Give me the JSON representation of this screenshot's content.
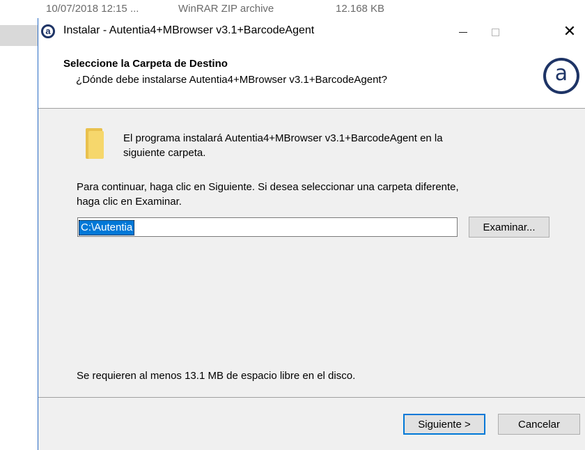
{
  "background_row": {
    "date": "10/07/2018 12:15 ...",
    "type": "WinRAR ZIP archive",
    "size": "12.168 KB"
  },
  "window": {
    "title": "Instalar - Autentia4+MBrowser v3.1+BarcodeAgent",
    "controls": {
      "minimize_icon": "minimize-icon",
      "maximize_icon": "maximize-icon",
      "close_label": "✕"
    }
  },
  "header": {
    "title": "Seleccione la Carpeta de Destino",
    "subtitle": "¿Dónde debe instalarse Autentia4+MBrowser v3.1+BarcodeAgent?",
    "logo_letter": "a",
    "logo_color": "#1e3466"
  },
  "body": {
    "intro_line1": "El programa instalará Autentia4+MBrowser v3.1+BarcodeAgent en la",
    "intro_line2": "siguiente carpeta.",
    "continue_line1": "Para continuar, haga clic en Siguiente. Si desea seleccionar una carpeta diferente,",
    "continue_line2": "haga clic en Examinar.",
    "destination_path": "C:\\Autentia",
    "browse_label": "Examinar...",
    "space_required": "Se requieren al menos 13.1 MB de espacio libre en el disco."
  },
  "footer": {
    "next_label": "Siguiente >",
    "cancel_label": "Cancelar"
  },
  "colors": {
    "accent": "#0078d7",
    "window_bg": "#f0f0f0",
    "folder": "#f6d76c"
  }
}
